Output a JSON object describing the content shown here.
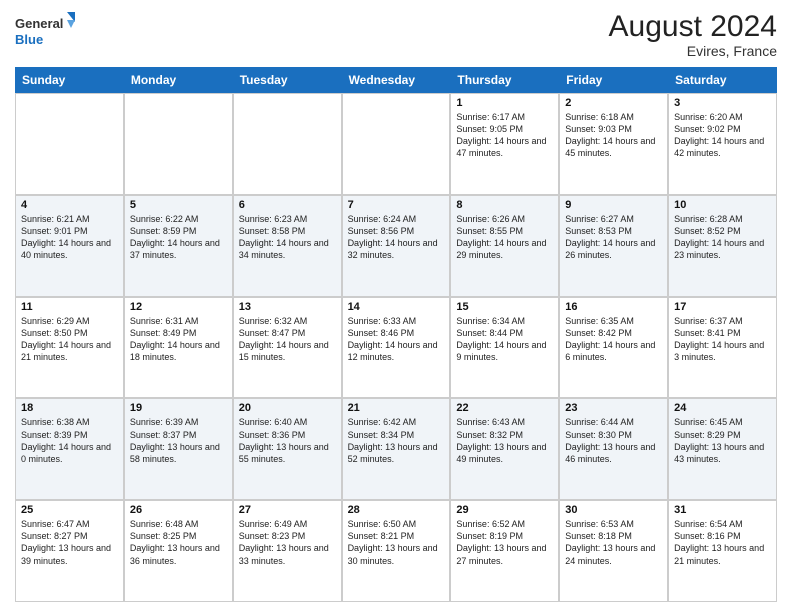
{
  "logo": {
    "line1": "General",
    "line2": "Blue"
  },
  "title": "August 2024",
  "location": "Evires, France",
  "header_days": [
    "Sunday",
    "Monday",
    "Tuesday",
    "Wednesday",
    "Thursday",
    "Friday",
    "Saturday"
  ],
  "weeks": [
    [
      {
        "day": "",
        "info": ""
      },
      {
        "day": "",
        "info": ""
      },
      {
        "day": "",
        "info": ""
      },
      {
        "day": "",
        "info": ""
      },
      {
        "day": "1",
        "info": "Sunrise: 6:17 AM\nSunset: 9:05 PM\nDaylight: 14 hours\nand 47 minutes."
      },
      {
        "day": "2",
        "info": "Sunrise: 6:18 AM\nSunset: 9:03 PM\nDaylight: 14 hours\nand 45 minutes."
      },
      {
        "day": "3",
        "info": "Sunrise: 6:20 AM\nSunset: 9:02 PM\nDaylight: 14 hours\nand 42 minutes."
      }
    ],
    [
      {
        "day": "4",
        "info": "Sunrise: 6:21 AM\nSunset: 9:01 PM\nDaylight: 14 hours\nand 40 minutes."
      },
      {
        "day": "5",
        "info": "Sunrise: 6:22 AM\nSunset: 8:59 PM\nDaylight: 14 hours\nand 37 minutes."
      },
      {
        "day": "6",
        "info": "Sunrise: 6:23 AM\nSunset: 8:58 PM\nDaylight: 14 hours\nand 34 minutes."
      },
      {
        "day": "7",
        "info": "Sunrise: 6:24 AM\nSunset: 8:56 PM\nDaylight: 14 hours\nand 32 minutes."
      },
      {
        "day": "8",
        "info": "Sunrise: 6:26 AM\nSunset: 8:55 PM\nDaylight: 14 hours\nand 29 minutes."
      },
      {
        "day": "9",
        "info": "Sunrise: 6:27 AM\nSunset: 8:53 PM\nDaylight: 14 hours\nand 26 minutes."
      },
      {
        "day": "10",
        "info": "Sunrise: 6:28 AM\nSunset: 8:52 PM\nDaylight: 14 hours\nand 23 minutes."
      }
    ],
    [
      {
        "day": "11",
        "info": "Sunrise: 6:29 AM\nSunset: 8:50 PM\nDaylight: 14 hours\nand 21 minutes."
      },
      {
        "day": "12",
        "info": "Sunrise: 6:31 AM\nSunset: 8:49 PM\nDaylight: 14 hours\nand 18 minutes."
      },
      {
        "day": "13",
        "info": "Sunrise: 6:32 AM\nSunset: 8:47 PM\nDaylight: 14 hours\nand 15 minutes."
      },
      {
        "day": "14",
        "info": "Sunrise: 6:33 AM\nSunset: 8:46 PM\nDaylight: 14 hours\nand 12 minutes."
      },
      {
        "day": "15",
        "info": "Sunrise: 6:34 AM\nSunset: 8:44 PM\nDaylight: 14 hours\nand 9 minutes."
      },
      {
        "day": "16",
        "info": "Sunrise: 6:35 AM\nSunset: 8:42 PM\nDaylight: 14 hours\nand 6 minutes."
      },
      {
        "day": "17",
        "info": "Sunrise: 6:37 AM\nSunset: 8:41 PM\nDaylight: 14 hours\nand 3 minutes."
      }
    ],
    [
      {
        "day": "18",
        "info": "Sunrise: 6:38 AM\nSunset: 8:39 PM\nDaylight: 14 hours\nand 0 minutes."
      },
      {
        "day": "19",
        "info": "Sunrise: 6:39 AM\nSunset: 8:37 PM\nDaylight: 13 hours\nand 58 minutes."
      },
      {
        "day": "20",
        "info": "Sunrise: 6:40 AM\nSunset: 8:36 PM\nDaylight: 13 hours\nand 55 minutes."
      },
      {
        "day": "21",
        "info": "Sunrise: 6:42 AM\nSunset: 8:34 PM\nDaylight: 13 hours\nand 52 minutes."
      },
      {
        "day": "22",
        "info": "Sunrise: 6:43 AM\nSunset: 8:32 PM\nDaylight: 13 hours\nand 49 minutes."
      },
      {
        "day": "23",
        "info": "Sunrise: 6:44 AM\nSunset: 8:30 PM\nDaylight: 13 hours\nand 46 minutes."
      },
      {
        "day": "24",
        "info": "Sunrise: 6:45 AM\nSunset: 8:29 PM\nDaylight: 13 hours\nand 43 minutes."
      }
    ],
    [
      {
        "day": "25",
        "info": "Sunrise: 6:47 AM\nSunset: 8:27 PM\nDaylight: 13 hours\nand 39 minutes."
      },
      {
        "day": "26",
        "info": "Sunrise: 6:48 AM\nSunset: 8:25 PM\nDaylight: 13 hours\nand 36 minutes."
      },
      {
        "day": "27",
        "info": "Sunrise: 6:49 AM\nSunset: 8:23 PM\nDaylight: 13 hours\nand 33 minutes."
      },
      {
        "day": "28",
        "info": "Sunrise: 6:50 AM\nSunset: 8:21 PM\nDaylight: 13 hours\nand 30 minutes."
      },
      {
        "day": "29",
        "info": "Sunrise: 6:52 AM\nSunset: 8:19 PM\nDaylight: 13 hours\nand 27 minutes."
      },
      {
        "day": "30",
        "info": "Sunrise: 6:53 AM\nSunset: 8:18 PM\nDaylight: 13 hours\nand 24 minutes."
      },
      {
        "day": "31",
        "info": "Sunrise: 6:54 AM\nSunset: 8:16 PM\nDaylight: 13 hours\nand 21 minutes."
      }
    ]
  ]
}
